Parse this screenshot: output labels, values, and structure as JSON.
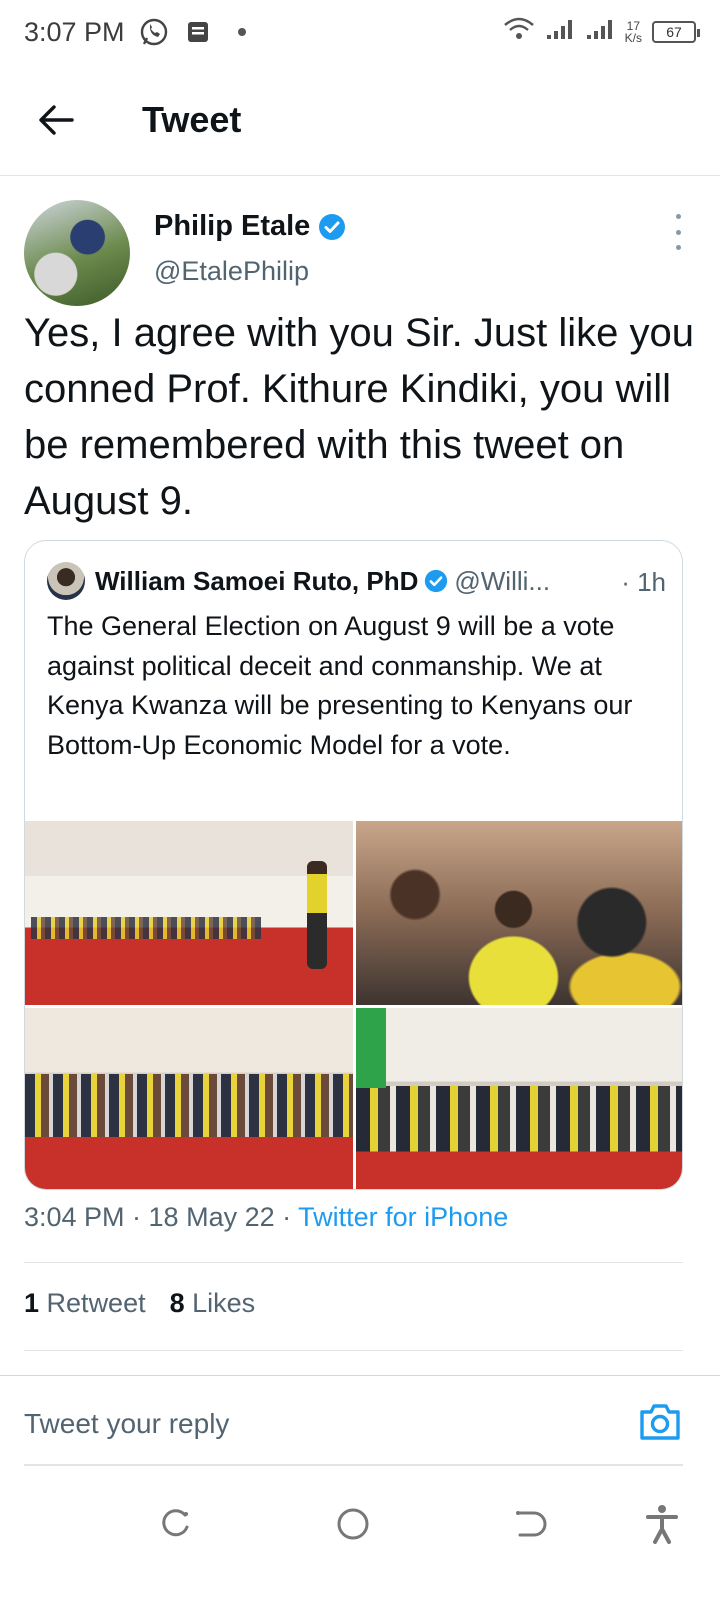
{
  "status_bar": {
    "time": "3:07 PM",
    "net_speed_value": "17",
    "net_speed_unit": "K/s",
    "battery": "67",
    "icons": [
      "whatsapp-icon",
      "message-icon",
      "dot-icon",
      "wifi-icon",
      "signal-icon",
      "signal-icon",
      "battery-icon"
    ]
  },
  "header": {
    "title": "Tweet",
    "back_icon": "back-arrow-icon"
  },
  "tweet": {
    "author_name": "Philip Etale",
    "author_handle": "@EtalePhilip",
    "verified": true,
    "text": "Yes, I agree with you Sir. Just like you conned Prof. Kithure Kindiki, you will be remembered with this tweet on August 9.",
    "quoted": {
      "author_name": "William Samoei Ruto, PhD",
      "author_handle": "@Willi...",
      "time": "· 1h",
      "verified": true,
      "text": "The General Election on August 9 will be a vote against political deceit and conmanship. We at Kenya Kwanza will be presenting to Kenyans our Bottom-Up Economic Model for a vote.",
      "photos": 4
    },
    "timestamp": "3:04 PM · 18 May 22 · ",
    "source": "Twitter for iPhone",
    "retweet_count": "1",
    "retweet_label": "Retweet",
    "like_count": "8",
    "like_label": "Likes"
  },
  "reply": {
    "placeholder": "Tweet your reply",
    "camera_icon": "camera-icon"
  },
  "nav": {
    "icons": [
      "recent-apps-icon",
      "home-circle-icon",
      "back-icon",
      "accessibility-icon"
    ]
  },
  "colors": {
    "accent": "#1d9bf0",
    "secondary_text": "#536471",
    "primary_text": "#0f1419",
    "border": "#cfd9de"
  }
}
